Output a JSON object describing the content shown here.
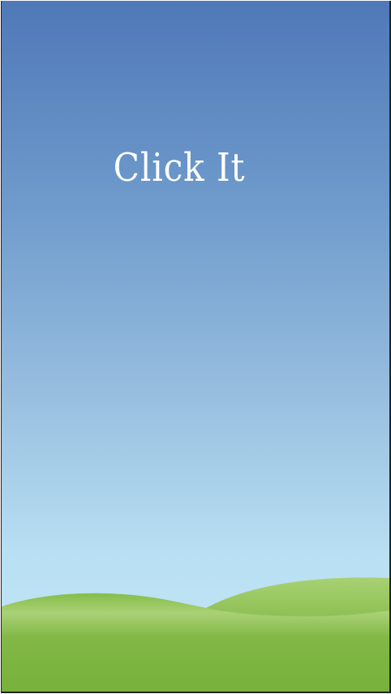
{
  "game": {
    "title": "Click It"
  },
  "colors": {
    "sky_top": "#4f78b8",
    "sky_bottom": "#c4e8f8",
    "grass_dark": "#7ab33c",
    "grass_light": "#a8d173"
  }
}
